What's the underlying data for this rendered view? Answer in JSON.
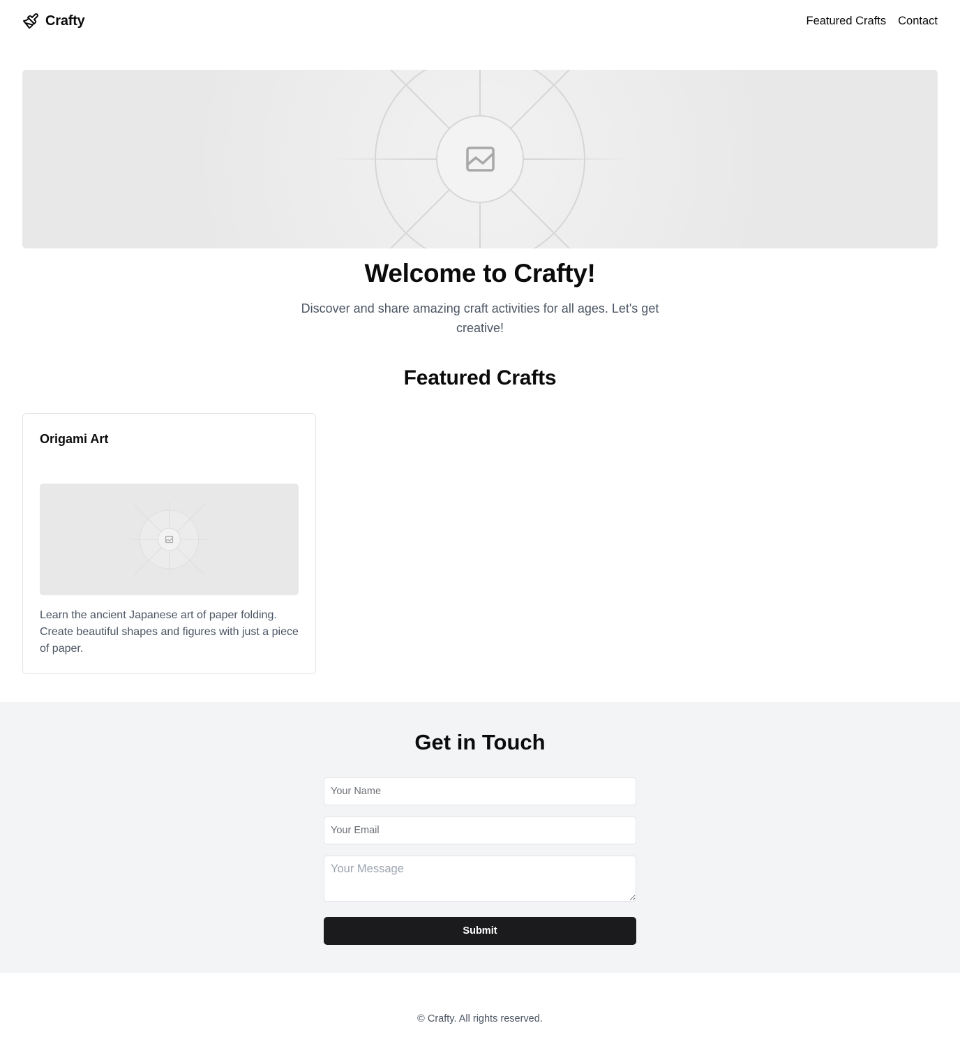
{
  "header": {
    "brand_name": "Crafty",
    "nav": [
      {
        "label": "Featured Crafts"
      },
      {
        "label": "Contact"
      }
    ]
  },
  "hero": {
    "title": "Welcome to Crafty!",
    "subtitle": "Discover and share amazing craft activities for all ages. Let's get creative!"
  },
  "featured": {
    "title": "Featured Crafts",
    "cards": [
      {
        "title": "Origami Art",
        "description": "Learn the ancient Japanese art of paper folding. Create beautiful shapes and figures with just a piece of paper."
      }
    ]
  },
  "contact": {
    "title": "Get in Touch",
    "name_placeholder": "Your Name",
    "email_placeholder": "Your Email",
    "message_placeholder": "Your Message",
    "submit_label": "Submit"
  },
  "footer": {
    "text": "© Crafty. All rights reserved."
  },
  "icons": {
    "brand": "paintbrush-icon",
    "placeholder": "image-placeholder-icon"
  },
  "colors": {
    "button_bg": "#1b1b1d",
    "contact_bg": "#f3f4f6",
    "muted_text": "#4b5563"
  }
}
